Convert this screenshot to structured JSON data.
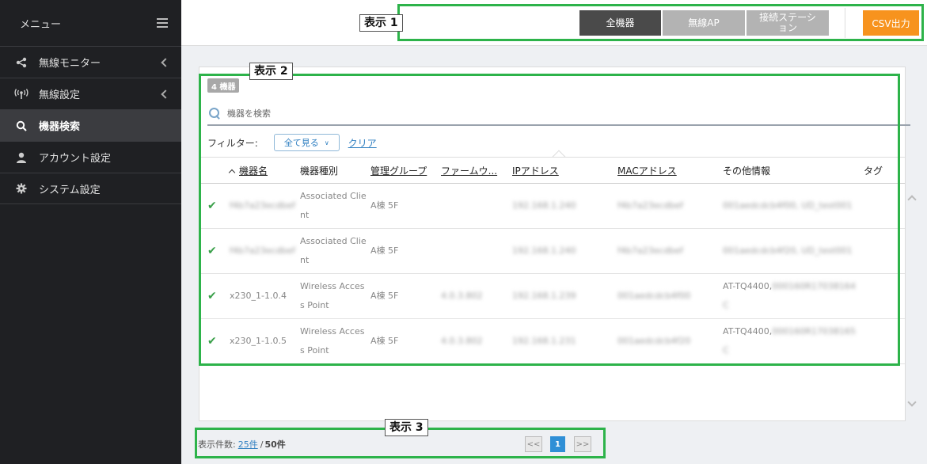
{
  "sidebar": {
    "title": "メニュー",
    "items": [
      {
        "label": "無線モニター",
        "icon": "share-icon",
        "chevron": true
      },
      {
        "label": "無線設定",
        "icon": "antenna-icon",
        "chevron": true
      },
      {
        "label": "機器検索",
        "icon": "search-icon",
        "chevron": false,
        "active": true
      },
      {
        "label": "アカウント設定",
        "icon": "user-icon",
        "chevron": false
      },
      {
        "label": "システム設定",
        "icon": "gear-icon",
        "chevron": false
      }
    ]
  },
  "toolbar": {
    "all_devices": "全機器",
    "wireless_ap": "無線AP",
    "stations": "接続ステーション",
    "csv": "CSV出力"
  },
  "annotations": {
    "label1": "表示 1",
    "label2": "表示 2",
    "label3": "表示 3",
    "color": "#2db34a"
  },
  "main": {
    "device_count": "4 機器",
    "search_placeholder": "機器を検索",
    "filter_label": "フィルター:",
    "filter_value": "全て見る",
    "clear": "クリア",
    "columns": [
      "機器名",
      "機器種別",
      "管理グループ",
      "ファームウ...",
      "IPアドレス",
      "MACアドレス",
      "その他情報",
      "タグ"
    ],
    "rows": [
      {
        "name": "f4b7a23ecdbef",
        "type": "Associated Client",
        "group": "A棟 5F",
        "firmware": "",
        "ip": "192.168.1.240",
        "mac": "f4b7a23ecdbef",
        "other_prefix": "",
        "other": "001aedcdcb4f00, UD_test001",
        "tag": ""
      },
      {
        "name": "f4b7a23ecdbef",
        "type": "Associated Client",
        "group": "A棟 5F",
        "firmware": "",
        "ip": "192.168.1.240",
        "mac": "f4b7a23ecdbef",
        "other_prefix": "",
        "other": "001aedcdcb4f20, UD_test001",
        "tag": ""
      },
      {
        "name": "x230_1-1.0.4",
        "type": "Wireless Access Point",
        "group": "A棟 5F",
        "firmware": "4.0.3.802",
        "ip": "192.168.1.239",
        "mac": "001aedcdcb4f00",
        "other_prefix": "AT-TQ4400,",
        "other": "000160R17038164C",
        "tag": ""
      },
      {
        "name": "x230_1-1.0.5",
        "type": "Wireless Access Point",
        "group": "A棟 5F",
        "firmware": "4.0.3.802",
        "ip": "192.168.1.231",
        "mac": "001aedcdcb4f20",
        "other_prefix": "AT-TQ4400,",
        "other": "000160R17038165C",
        "tag": ""
      }
    ]
  },
  "footer": {
    "label": "表示件数:",
    "per_page": "25件",
    "separator": "/",
    "total": "50件",
    "prev": "<<",
    "page": "1",
    "next": ">>"
  }
}
